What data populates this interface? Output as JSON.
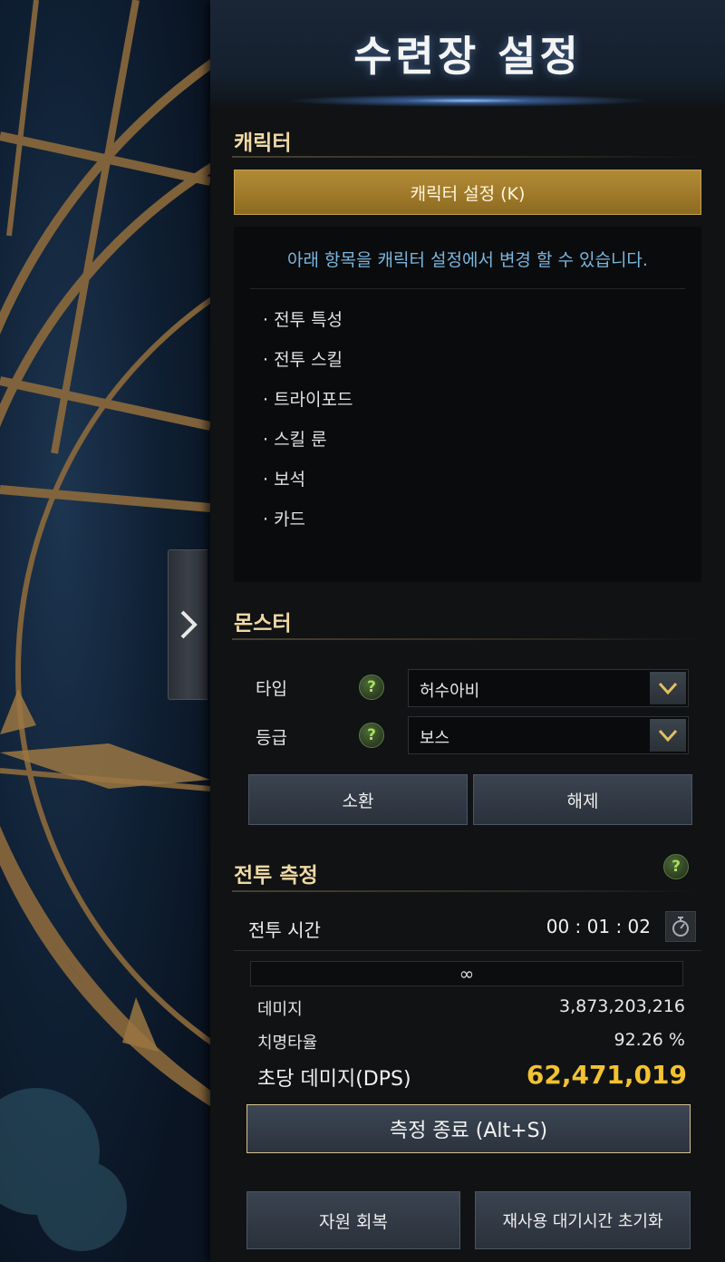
{
  "header": {
    "title": "수련장 설정"
  },
  "character": {
    "section_title": "캐릭터",
    "settings_button": "캐릭터 설정 (K)",
    "info_text": "아래 항목을 캐릭터 설정에서 변경 할 수 있습니다.",
    "items": [
      "· 전투 특성",
      "· 전투 스킬",
      "· 트라이포드",
      "· 스킬 룬",
      "· 보석",
      "· 카드"
    ]
  },
  "monster": {
    "section_title": "몬스터",
    "type_label": "타입",
    "type_value": "허수아비",
    "grade_label": "등급",
    "grade_value": "보스",
    "help_icon": "?",
    "summon_button": "소환",
    "release_button": "해제"
  },
  "combat": {
    "section_title": "전투 측정",
    "help_icon": "?",
    "time_label": "전투 시간",
    "time_value": "00 : 01 : 02",
    "hp_value": "∞",
    "damage_label": "데미지",
    "damage_value": "3,873,203,216",
    "crit_label": "치명타율",
    "crit_value": "92.26 %",
    "dps_label": "초당 데미지(DPS)",
    "dps_value": "62,471,019",
    "end_button": "측정 종료 (Alt+S)"
  },
  "footer": {
    "recover_button": "자원 회복",
    "cooldown_button": "재사용 대기시간 초기화"
  },
  "icons": {
    "collapse": "chevron-right-icon",
    "dropdown": "chevron-down-icon",
    "help": "help-icon",
    "timer": "stopwatch-icon"
  },
  "colors": {
    "accent_gold": "#a07a2a",
    "dps_yellow": "#f2c230",
    "info_blue": "#7ab6de",
    "section_title": "#f0d9a4",
    "help_green": "#a6e05a"
  }
}
